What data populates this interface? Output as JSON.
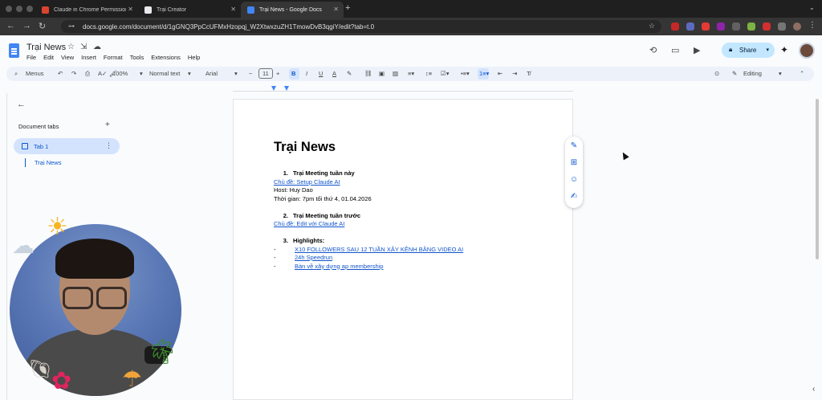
{
  "browser": {
    "tabs": [
      {
        "title": "Claude in Chrome Permissions",
        "favicon_color": "#d9432f"
      },
      {
        "title": "Trại Creator",
        "favicon_color": "#e8eaed"
      },
      {
        "title": "Trại News - Google Docs",
        "favicon_color": "#4285f4",
        "active": true
      }
    ],
    "new_tab": "+",
    "url": "docs.google.com/document/d/1gGNQ3PpCcUFMxHzopqj_W2XtwxzuZH1TmowDvB3qgiY/edit?tab=t.0"
  },
  "doc": {
    "title": "Trại News",
    "menus": [
      "File",
      "Edit",
      "View",
      "Insert",
      "Format",
      "Tools",
      "Extensions",
      "Help"
    ],
    "share_label": "Share"
  },
  "toolbar": {
    "search_menus": "Menus",
    "zoom": "100%",
    "style": "Normal text",
    "font": "Arial",
    "font_size": "11",
    "mode": "Editing"
  },
  "sidebar": {
    "back": "←",
    "heading": "Document tabs",
    "add": "+",
    "tab_label": "Tab 1",
    "outline_item": "Trại News"
  },
  "content": {
    "heading": "Trại News",
    "sections": [
      {
        "num": "1.",
        "title": "Trại Meeting tuần này",
        "link": "Chủ đề: Setup Claude AI",
        "lines": [
          "Host: Huy Dao",
          "Thời gian: 7pm tối thứ 4, 01.04.2026"
        ]
      },
      {
        "num": "2.",
        "title": "Trại Meeting tuần trước",
        "link": "Chủ đề: Edit với Claude AI"
      },
      {
        "num": "3.",
        "title": "Highlights:",
        "bullets": [
          "X10 FOLLOWERS SAU 12 TUẦN XÂY KÊNH BẰNG VIDEO AI",
          "24h Speedrun",
          "Bàn về xây dựng ap membership"
        ]
      }
    ]
  }
}
